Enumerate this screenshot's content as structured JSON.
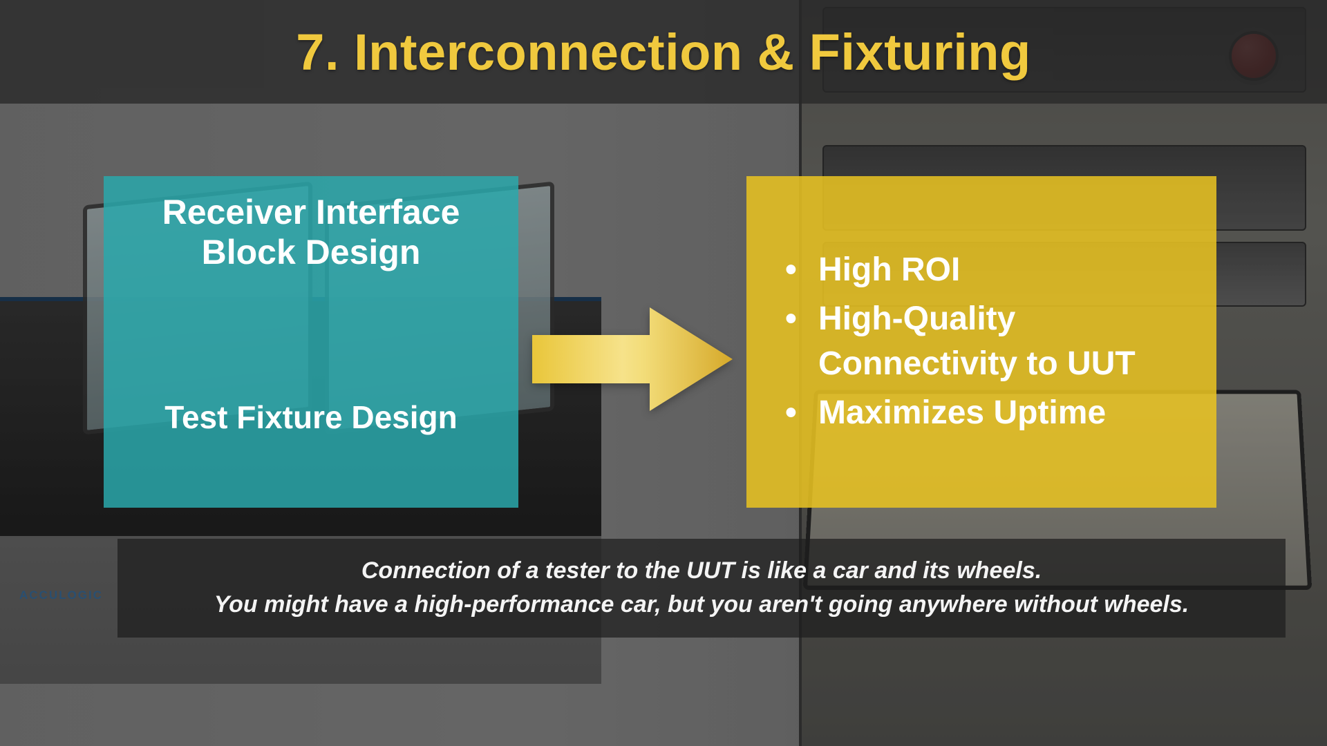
{
  "title": "7. Interconnection & Fixturing",
  "teal": {
    "heading_line1": "Receiver Interface",
    "heading_line2": "Block Design",
    "footer": "Test Fixture Design"
  },
  "bullets": {
    "b1": "High ROI",
    "b2": "High-Quality Connectivity to UUT",
    "b3": "Maximizes Uptime"
  },
  "caption": {
    "line1": "Connection of a tester to the UUT is like a car and its wheels.",
    "line2": "You might have a high-performance car, but you aren't going anywhere without wheels."
  },
  "logo_text": "ACCULOGIC",
  "colors": {
    "title": "#f0c93e",
    "teal": "rgba(42,168,171,0.85)",
    "yellow": "rgba(231,194,34,0.88)"
  }
}
